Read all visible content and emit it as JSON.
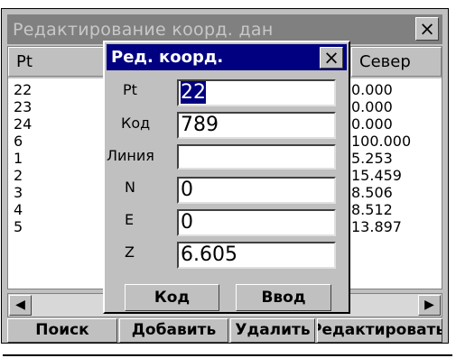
{
  "outer_window": {
    "title": "Редактирование коорд. дан",
    "close_glyph": "×",
    "columns": {
      "pt": "Pt",
      "north": "Север"
    },
    "rows_pt": [
      "22",
      "23",
      "24",
      "6",
      "1",
      "2",
      "3",
      "4",
      "5"
    ],
    "rows_north": [
      "0.000",
      "0.000",
      "0.000",
      "100.000",
      "5.253",
      "15.459",
      "8.506",
      "8.512",
      "13.897"
    ],
    "scroll_left": "◀",
    "scroll_right": "▶",
    "buttons": {
      "search": "Поиск",
      "add": "Добавить",
      "delete": "Удалить",
      "edit": "Редактировать"
    }
  },
  "dialog": {
    "title": "Ред. коорд.",
    "close_glyph": "×",
    "fields": [
      {
        "label": "Pt",
        "value": "22"
      },
      {
        "label": "Код",
        "value": "789"
      },
      {
        "label": "Линия",
        "value": ""
      },
      {
        "label": "N",
        "value": "0"
      },
      {
        "label": "E",
        "value": "0"
      },
      {
        "label": "Z",
        "value": "6.605"
      }
    ],
    "buttons": {
      "code": "Код",
      "enter": "Ввод"
    }
  }
}
